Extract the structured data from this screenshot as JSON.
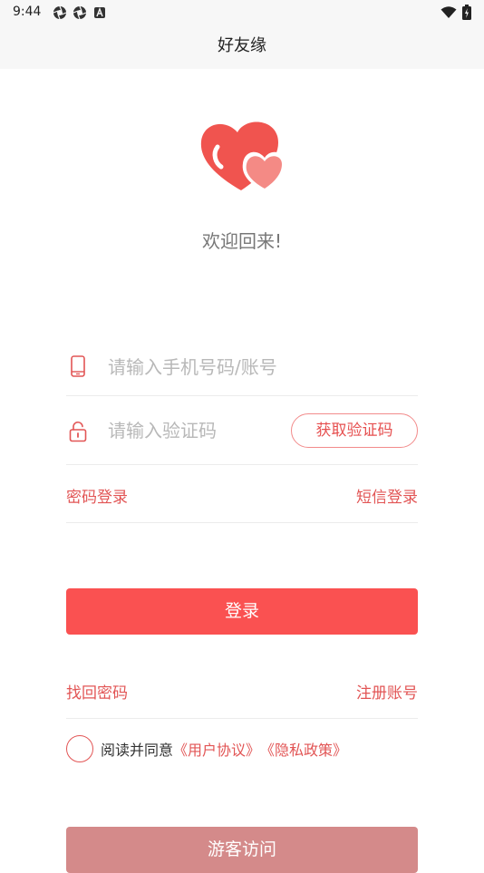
{
  "status_bar": {
    "time": "9:44",
    "icons": [
      "aperture-icon",
      "aperture-icon",
      "text-a-icon"
    ],
    "right_icons": [
      "wifi-icon",
      "battery-icon"
    ]
  },
  "header": {
    "title": "好友缘"
  },
  "welcome": {
    "text": "欢迎回来!"
  },
  "form": {
    "phone": {
      "placeholder": "请输入手机号码/账号",
      "value": ""
    },
    "code": {
      "placeholder": "请输入验证码",
      "value": "",
      "get_code_label": "获取验证码"
    },
    "switch": {
      "password_login": "密码登录",
      "sms_login": "短信登录"
    }
  },
  "login_button": {
    "label": "登录"
  },
  "links": {
    "find_password": "找回密码",
    "register": "注册账号"
  },
  "agreement": {
    "prefix": "阅读并同意",
    "user_agreement": "《用户协议》",
    "privacy_policy": "《隐私政策》"
  },
  "guest_button": {
    "label": "游客访问"
  },
  "colors": {
    "accent": "#fa5151",
    "link": "#e25555",
    "guest": "#d48a8a",
    "heart_dark": "#f0544f",
    "heart_light": "#f48a85"
  }
}
